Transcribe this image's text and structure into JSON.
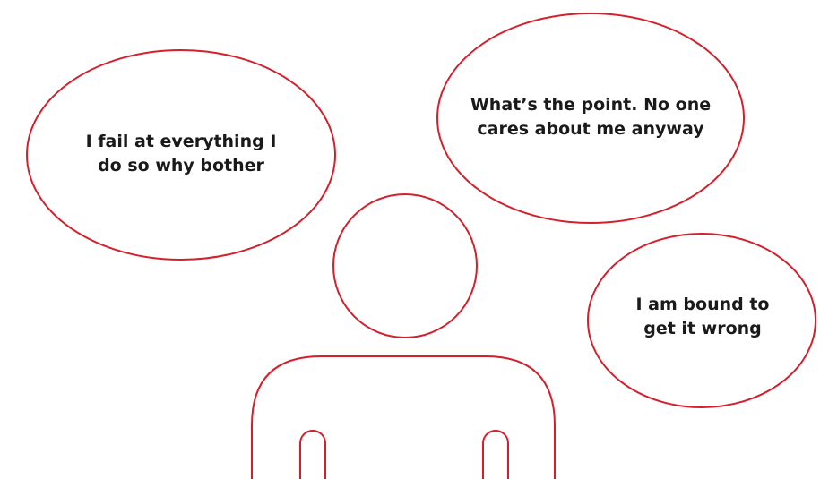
{
  "colors": {
    "outline": "#d4202c",
    "text": "#1a1a1a",
    "background": "#ffffff"
  },
  "thought_bubbles": [
    {
      "lines": [
        "I fail at everything I",
        "do so why bother"
      ]
    },
    {
      "lines": [
        "What’s the point. No one",
        "cares about me anyway"
      ]
    },
    {
      "lines": [
        "I am bound to",
        "get it wrong"
      ]
    }
  ],
  "figure": {
    "icon": "person-outline-icon"
  }
}
